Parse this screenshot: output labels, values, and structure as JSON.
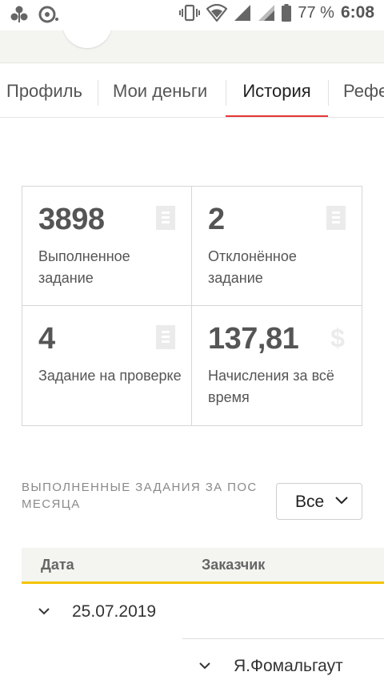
{
  "status_bar": {
    "battery": "77 %",
    "time": "6:08",
    "icons": [
      "app-icon",
      "alarm-icon",
      "vibrate-icon",
      "wifi-icon",
      "signal-icon",
      "signal-icon",
      "battery-icon"
    ]
  },
  "tabs": [
    {
      "label": "Профиль",
      "active": false
    },
    {
      "label": "Мои деньги",
      "active": false
    },
    {
      "label": "История",
      "active": true
    },
    {
      "label": "Рефе",
      "active": false
    }
  ],
  "stats": [
    {
      "value": "3898",
      "label": "Выполненное задание",
      "icon": "document-icon"
    },
    {
      "value": "2",
      "label": "Отклонённое задание",
      "icon": "document-icon"
    },
    {
      "value": "4",
      "label": "Задание на проверке",
      "icon": "document-icon"
    },
    {
      "value": "137,81",
      "label": "Начисления за всё время",
      "icon": "dollar-icon"
    }
  ],
  "section": {
    "title_line1": "ВЫПОЛНЕННЫЕ ЗАДАНИЯ ЗА ПОС",
    "title_line2": "МЕСЯЦА"
  },
  "filter": {
    "selected": "Все"
  },
  "table": {
    "columns": [
      "Дата",
      "Заказчик"
    ],
    "rows": [
      {
        "date": "25.07.2019",
        "customer": "Я.Фомальгаут"
      }
    ]
  },
  "colors": {
    "accent_tab": "#e63737",
    "table_border": "#f4c400",
    "header_bg": "#f4f4f1"
  }
}
